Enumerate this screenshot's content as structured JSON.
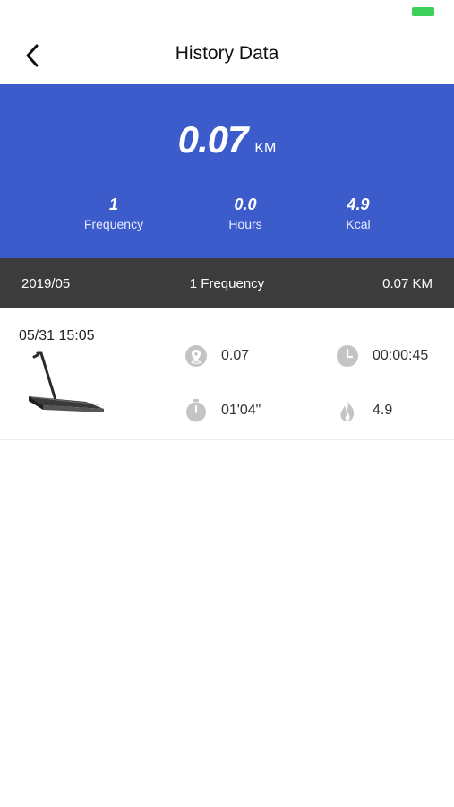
{
  "header": {
    "title": "History Data"
  },
  "summary": {
    "distance_value": "0.07",
    "distance_unit": "KM",
    "stats": [
      {
        "value": "1",
        "label": "Frequency"
      },
      {
        "value": "0.0",
        "label": "Hours"
      },
      {
        "value": "4.9",
        "label": "Kcal"
      }
    ]
  },
  "month": {
    "date": "2019/05",
    "frequency": "1 Frequency",
    "distance": "0.07 KM"
  },
  "records": [
    {
      "datetime": "05/31 15:05",
      "distance": "0.07",
      "duration": "00:00:45",
      "pace": "01'04\"",
      "calories": "4.9"
    }
  ],
  "colors": {
    "hero": "#3c5ccb",
    "month_bar": "#3c3c3c",
    "battery": "#3ecf5a",
    "icon": "#c4c4c4"
  },
  "icons": [
    "back-arrow-icon",
    "location-pin-icon",
    "clock-icon",
    "stopwatch-icon",
    "flame-icon",
    "treadmill-image"
  ]
}
